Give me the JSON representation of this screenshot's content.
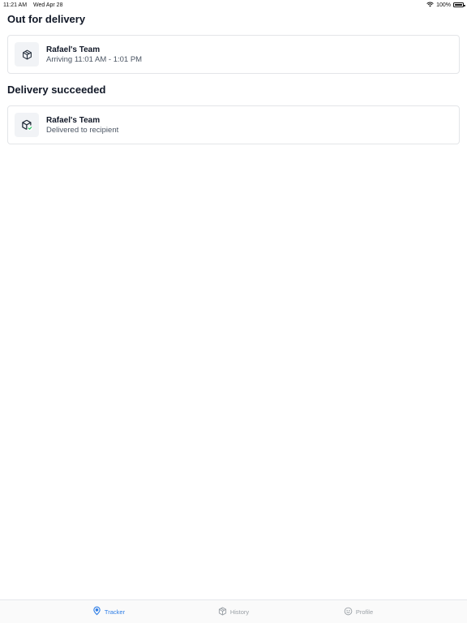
{
  "status_bar": {
    "time": "11:21 AM",
    "date": "Wed Apr 28",
    "battery_percent": "100%",
    "battery_level": 1.0,
    "wifi_icon": "wifi-icon"
  },
  "sections": [
    {
      "title": "Out for delivery",
      "card": {
        "icon": "package-icon",
        "title": "Rafael's Team",
        "subtitle": "Arriving 11:01 AM - 1:01 PM"
      }
    },
    {
      "title": "Delivery succeeded",
      "card": {
        "icon": "package-delivered-icon",
        "title": "Rafael's Team",
        "subtitle": "Delivered to recipient"
      }
    }
  ],
  "tab_bar": {
    "active_color": "#2f7ee6",
    "inactive_color": "#9aa0a6",
    "tabs": [
      {
        "label": "Tracker",
        "icon": "location-pin-icon",
        "active": true
      },
      {
        "label": "History",
        "icon": "package-icon",
        "active": false
      },
      {
        "label": "Profile",
        "icon": "smiley-icon",
        "active": false
      }
    ]
  }
}
